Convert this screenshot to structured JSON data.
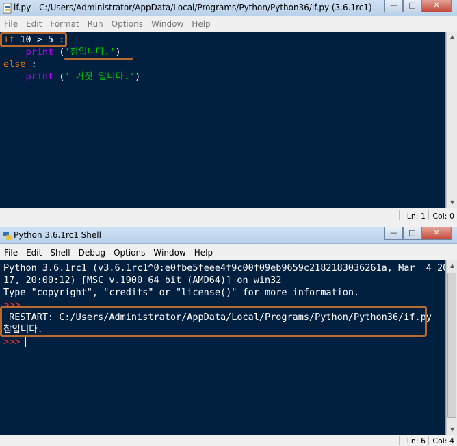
{
  "editor": {
    "title": "if.py - C:/Users/Administrator/AppData/Local/Programs/Python/Python36/if.py (3.6.1rc1)",
    "menu": [
      "File",
      "Edit",
      "Format",
      "Run",
      "Options",
      "Window",
      "Help"
    ],
    "code": {
      "line1": {
        "kw": "if",
        "rest": " 10 > 5 :"
      },
      "line2": {
        "indent": "    ",
        "kw": "print",
        "paren_open": " (",
        "str": "'참입니다.'",
        "paren_close": ")"
      },
      "line3": {
        "kw": "else",
        "rest": " :"
      },
      "line4": {
        "indent": "    ",
        "kw": "print",
        "paren_open": " (",
        "str": "' 거짓 입니다.'",
        "paren_close": ")"
      }
    },
    "status": {
      "ln": "Ln: 1",
      "col": "Col: 0"
    }
  },
  "shell": {
    "title": "Python 3.6.1rc1 Shell",
    "menu": [
      "File",
      "Edit",
      "Shell",
      "Debug",
      "Options",
      "Window",
      "Help"
    ],
    "output": {
      "line1": "Python 3.6.1rc1 (v3.6.1rc1^0:e0fbe5feee4f9c00f09eb9659c2182183036261a, Mar  4 20",
      "line2": "17, 20:00:12) [MSC v.1900 64 bit (AMD64)] on win32",
      "line3": "Type \"copyright\", \"credits\" or \"license()\" for more information.",
      "prompt1": ">>>",
      "restart": " RESTART: C:/Users/Administrator/AppData/Local/Programs/Python/Python36/if.py",
      "result": "참입니다.",
      "prompt2": ">>> "
    },
    "status": {
      "ln": "Ln: 6",
      "col": "Col: 4"
    }
  },
  "colors": {
    "background": "#012040",
    "keyword_orange": "#ff7700",
    "builtin_purple": "#c000ff",
    "string_green": "#00cc00",
    "prompt_red": "#ff3030",
    "annotation_brown": "#b86a2c"
  }
}
